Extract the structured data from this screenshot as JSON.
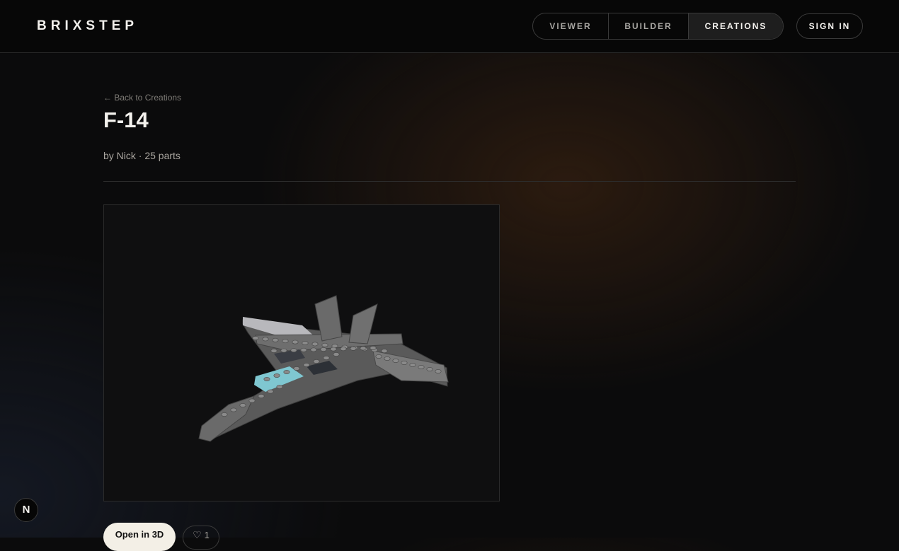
{
  "header": {
    "logo": "BRIXSTEP",
    "nav": [
      {
        "label": "VIEWER",
        "active": false
      },
      {
        "label": "BUILDER",
        "active": false
      },
      {
        "label": "CREATIONS",
        "active": true
      }
    ],
    "sign_in_label": "SIGN IN"
  },
  "main": {
    "back_link": "← Back to Creations",
    "title": "F-14",
    "meta": "by Nick · 25 parts",
    "model_image_icon": "brick-jet-model"
  },
  "actions": {
    "open_3d_label": "Open in 3D",
    "like_icon": "heart-icon",
    "like_glyph": "♡",
    "like_count": "1"
  },
  "badge": {
    "letter": "N",
    "icon": "nextjs-badge-icon"
  },
  "colors": {
    "background": "#0b0b0c",
    "brick_gray": "#6b6b6b",
    "canopy": "#7fc7d1"
  }
}
